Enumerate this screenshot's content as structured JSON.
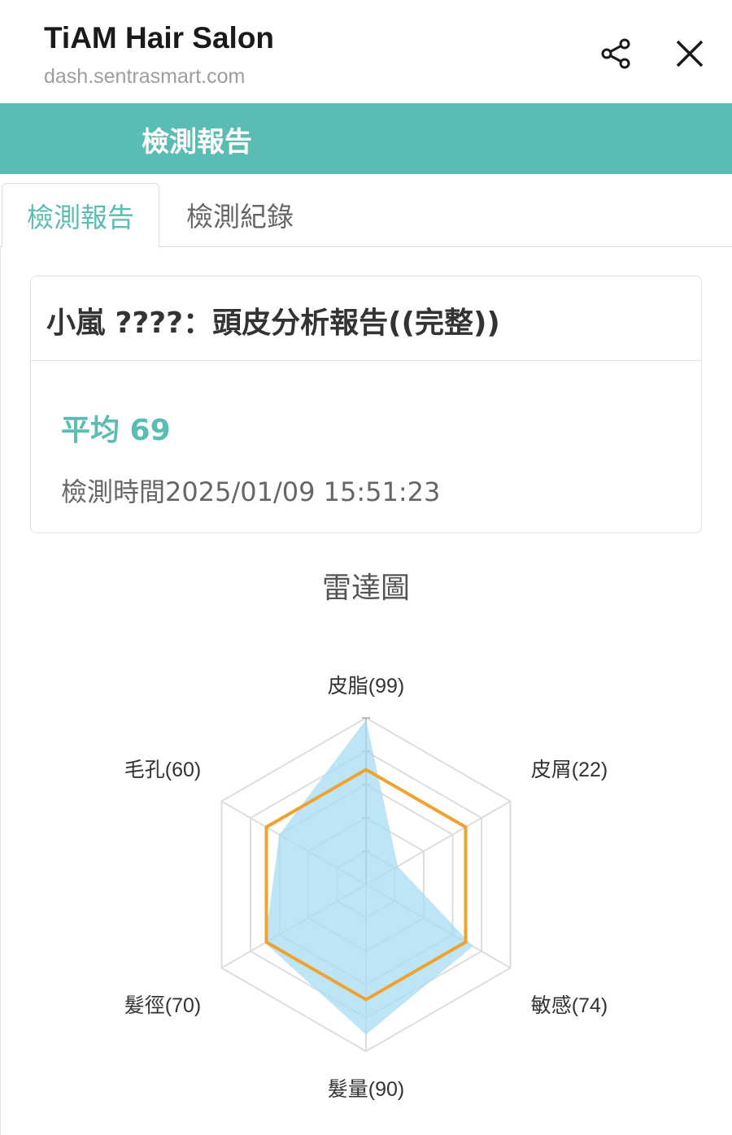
{
  "app": {
    "title": "TiAM Hair Salon",
    "url": "dash.sentrasmart.com"
  },
  "icons": {
    "share": "share-icon",
    "close": "close-icon"
  },
  "header": {
    "title": "檢測報告"
  },
  "tabs": [
    {
      "label": "檢測報告",
      "active": true
    },
    {
      "label": "檢測紀錄",
      "active": false
    }
  ],
  "report": {
    "title": "小嵐 ????：頭皮分析報告((完整))",
    "average": "平均 69",
    "time": "檢測時間2025/01/09 15:51:23"
  },
  "colors": {
    "accent": "#5bbcb3",
    "series_fill": "#a8dcf2",
    "series_line": "#f0a22e",
    "grid": "#dddddd"
  },
  "chart_data": {
    "type": "radar",
    "title": "雷達圖",
    "axes": [
      "皮脂(99)",
      "皮屑(22)",
      "敏感(74)",
      "髮量(90)",
      "髮徑(70)",
      "毛孔(60)"
    ],
    "range": [
      0,
      100
    ],
    "series": [
      {
        "style": "filled",
        "values": [
          99,
          22,
          74,
          90,
          70,
          60
        ]
      },
      {
        "style": "line",
        "values": [
          69,
          69,
          69,
          69,
          69,
          69
        ]
      }
    ]
  }
}
